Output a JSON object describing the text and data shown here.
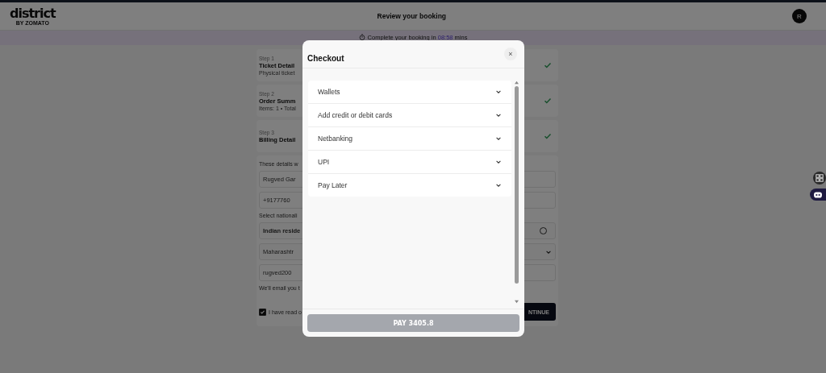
{
  "header": {
    "logo": "district",
    "logo_sub": "BY ZOMATO",
    "title": "Review your booking",
    "avatar": "R"
  },
  "banner": {
    "text": "Complete your booking in",
    "timer": "08:58",
    "unit": "mins"
  },
  "steps": [
    {
      "step": "Step 1",
      "title": "Ticket Detail",
      "detail": "Physical ticket",
      "done": true
    },
    {
      "step": "Step 2",
      "title": "Order Summ",
      "detail": "Items: 1 • Total",
      "done": true
    },
    {
      "step": "Step 3",
      "title": "Billing Detail",
      "done": true
    }
  ],
  "billing": {
    "note": "These details w",
    "name": "Rugved Gar",
    "phone": "+9177760",
    "nationality_label": "Select nationali",
    "nationality": {
      "label": "Indian reside",
      "selected": false
    },
    "state": "Maharashtr",
    "email": "rugved200",
    "email_note": "We'll email you t",
    "consent": {
      "text": "I have read o",
      "checked": true
    },
    "continue": "NTINUE"
  },
  "modal": {
    "title": "Checkout",
    "close": "×",
    "options": [
      {
        "label": "Wallets",
        "expanded": false
      },
      {
        "label": "Add credit or debit cards",
        "expanded": false
      },
      {
        "label": "Netbanking",
        "expanded": false
      },
      {
        "label": "UPI",
        "expanded": false
      },
      {
        "label": "Pay Later",
        "expanded": false
      }
    ],
    "pay_button": {
      "label": "PAY 3405.8",
      "disabled": true
    }
  }
}
